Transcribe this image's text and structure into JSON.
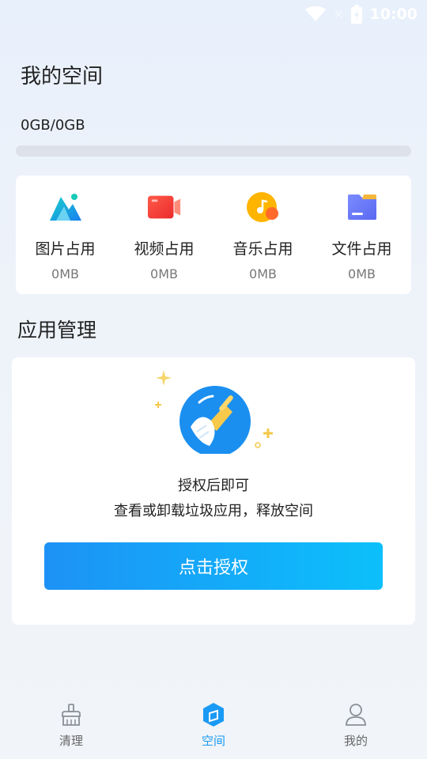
{
  "status_bar": {
    "time": "10:00"
  },
  "header": {
    "title": "我的空间"
  },
  "storage": {
    "usage_text": "0GB/0GB",
    "used_fraction": 0
  },
  "usage": {
    "items": [
      {
        "label": "图片占用",
        "value": "0MB",
        "icon": "image-icon"
      },
      {
        "label": "视频占用",
        "value": "0MB",
        "icon": "video-icon"
      },
      {
        "label": "音乐占用",
        "value": "0MB",
        "icon": "music-icon"
      },
      {
        "label": "文件占用",
        "value": "0MB",
        "icon": "folder-icon"
      }
    ]
  },
  "app_management": {
    "title": "应用管理",
    "line1": "授权后即可",
    "line2": "查看或卸载垃圾应用，释放空间",
    "button_label": "点击授权"
  },
  "nav": {
    "items": [
      {
        "label": "清理",
        "icon": "broom-icon",
        "active": false
      },
      {
        "label": "空间",
        "icon": "cube-icon",
        "active": true
      },
      {
        "label": "我的",
        "icon": "user-icon",
        "active": false
      }
    ]
  },
  "colors": {
    "accent": "#1a9af5",
    "button_start": "#1d92f6",
    "button_end": "#0cc0fb"
  }
}
